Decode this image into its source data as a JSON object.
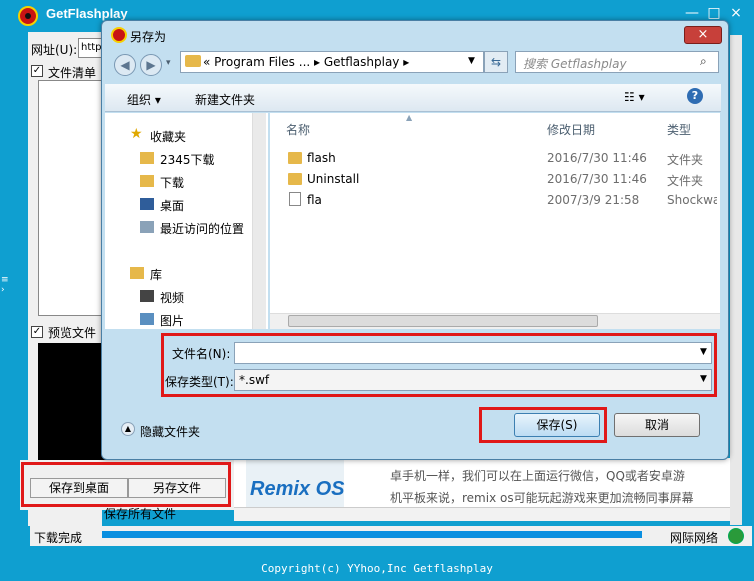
{
  "app": {
    "title": "GetFlashplay",
    "url_label": "网址(U):",
    "url_value": "http",
    "list_label": "文件清单",
    "preview_label": "预览文件",
    "save_desktop": "保存到桌面",
    "save_as": "另存文件",
    "save_all": "保存所有文件",
    "status": "下载完成",
    "network": "网际网络",
    "copyright": "Copyright(c) YYhoo,Inc Getflashplay",
    "news_line1": "卓手机一样，我们可以在上面运行微信，QQ或者安卓游",
    "news_line2": "机平板来说，remix os可能玩起游戏来更加流畅同事屏幕",
    "news_logo": "Remix OS"
  },
  "dialog": {
    "title": "另存为",
    "breadcrumb": "«  Program Files ...  ▸  Getflashplay  ▸",
    "search_placeholder": "搜索 Getflashplay",
    "organize": "组织 ▾",
    "new_folder": "新建文件夹",
    "nav": [
      "收藏夹",
      "2345下载",
      "下载",
      "桌面",
      "最近访问的位置",
      "库",
      "视频",
      "图片"
    ],
    "columns": {
      "name": "名称",
      "date": "修改日期",
      "type": "类型"
    },
    "files": [
      {
        "name": "flash",
        "date": "2016/7/30 11:46",
        "type": "文件夹"
      },
      {
        "name": "Uninstall",
        "date": "2016/7/30 11:46",
        "type": "文件夹"
      },
      {
        "name": "fla",
        "date": "2007/3/9 21:58",
        "type": "Shockwa"
      }
    ],
    "filename_label": "文件名(N):",
    "filename_value": "",
    "filetype_label": "保存类型(T):",
    "filetype_value": "*.swf",
    "hide_folders": "隐藏文件夹",
    "save": "保存(S)",
    "cancel": "取消"
  },
  "colors": {
    "accent": "#0f9fd0",
    "highlight": "#e01818"
  }
}
